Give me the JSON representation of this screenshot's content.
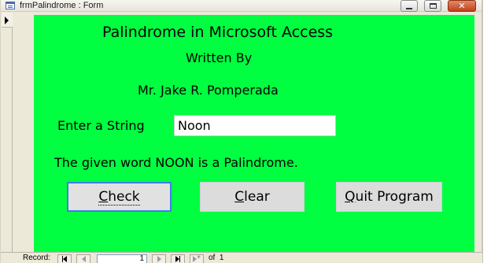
{
  "window": {
    "title": "frmPalindrome : Form",
    "icon": "form-icon",
    "controls": {
      "minimize": "minimize-icon",
      "maximize": "maximize-icon",
      "close": "close-icon",
      "close_glyph": "✕"
    }
  },
  "colors": {
    "form_background": "#00ff41",
    "button_background": "#dcdcdc",
    "focus_border": "#3d7ee8"
  },
  "form": {
    "title": "Palindrome in Microsoft Access",
    "written_by": "Written By",
    "author": "Mr. Jake R. Pomperada",
    "input_label": "Enter a String",
    "input_value": "Noon",
    "result_text": "The given word NOON is a Palindrome.",
    "buttons": {
      "check": {
        "first": "C",
        "rest": "heck"
      },
      "clear": {
        "first": "C",
        "rest": "lear"
      },
      "quit": {
        "first": "Q",
        "rest": "uit Program"
      }
    }
  },
  "navigation": {
    "record_label": "Record:",
    "current_record": "1",
    "of_label": "of",
    "total_records": "1"
  }
}
